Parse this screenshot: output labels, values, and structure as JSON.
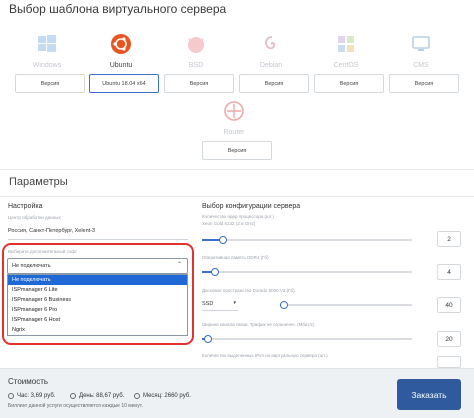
{
  "page_title": "Выбор шаблона виртуального сервера",
  "os_templates": [
    {
      "name": "Windows",
      "icon": "windows-icon",
      "version": "Версия",
      "active": false
    },
    {
      "name": "Ubuntu",
      "icon": "ubuntu-icon",
      "version": "Ubuntu 18.04 x64",
      "active": true
    },
    {
      "name": "BSD",
      "icon": "bsd-icon",
      "version": "Версия",
      "active": false
    },
    {
      "name": "Debian",
      "icon": "debian-icon",
      "version": "Версия",
      "active": false
    },
    {
      "name": "CentOS",
      "icon": "centos-icon",
      "version": "Версия",
      "active": false
    },
    {
      "name": "CMS",
      "icon": "cms-icon",
      "version": "Версия",
      "active": false
    },
    {
      "name": "Router",
      "icon": "router-icon",
      "version": "Версия",
      "active": false
    }
  ],
  "params": {
    "title": "Параметры",
    "settings": {
      "title": "Настройка",
      "datacenter_label": "Центр обработки данных",
      "datacenter_value": "Россия, Санкт-Петербург, Xelent-3",
      "software_label": "Выберите дополнительный софт",
      "software_value": "Не подключать",
      "software_options": [
        "Не подключать",
        "ISPmanager 6 Lite",
        "ISPmanager 6 Business",
        "ISPmanager 6 Pro",
        "ISPmanager 6 Host",
        "Ngrix"
      ]
    },
    "config": {
      "title": "Выбор конфигурации сервера",
      "cpu_label": "Количество ядер процессора (шт.)",
      "cpu_sub": "Xeon Gold 6132 (2.6 GHz)",
      "cpu_value": "2",
      "cpu_level": 0.1,
      "ram_label": "Оперативная память DDR4 (Гб)",
      "ram_value": "4",
      "ram_level": 0.06,
      "disk_label": "Дисковое пространство Dorado 5000 V3 (Гб)",
      "disk_type": "SSD",
      "disk_value": "40",
      "disk_level": 0.03,
      "net_label": "Ширина канала связи. Трафик не ограничен. (Мбит/с)",
      "net_value": "20",
      "net_level": 0.03,
      "ipv4_label": "Количество выделенных IPv4 на виртуальную сервера (шт.)"
    }
  },
  "footer": {
    "cost_title": "Стоимость",
    "hour": "Час: 3,69 руб.",
    "day": "День: 88,67 руб.",
    "month": "Месяц: 2660 руб.",
    "note": "Биллинг данной услуги осуществляется каждые 10 минут.",
    "order_label": "Заказать"
  },
  "colors": {
    "accent": "#3b6fc9",
    "highlight": "#e3312d",
    "ubuntu": "#e95420",
    "button": "#2f5b9e"
  }
}
